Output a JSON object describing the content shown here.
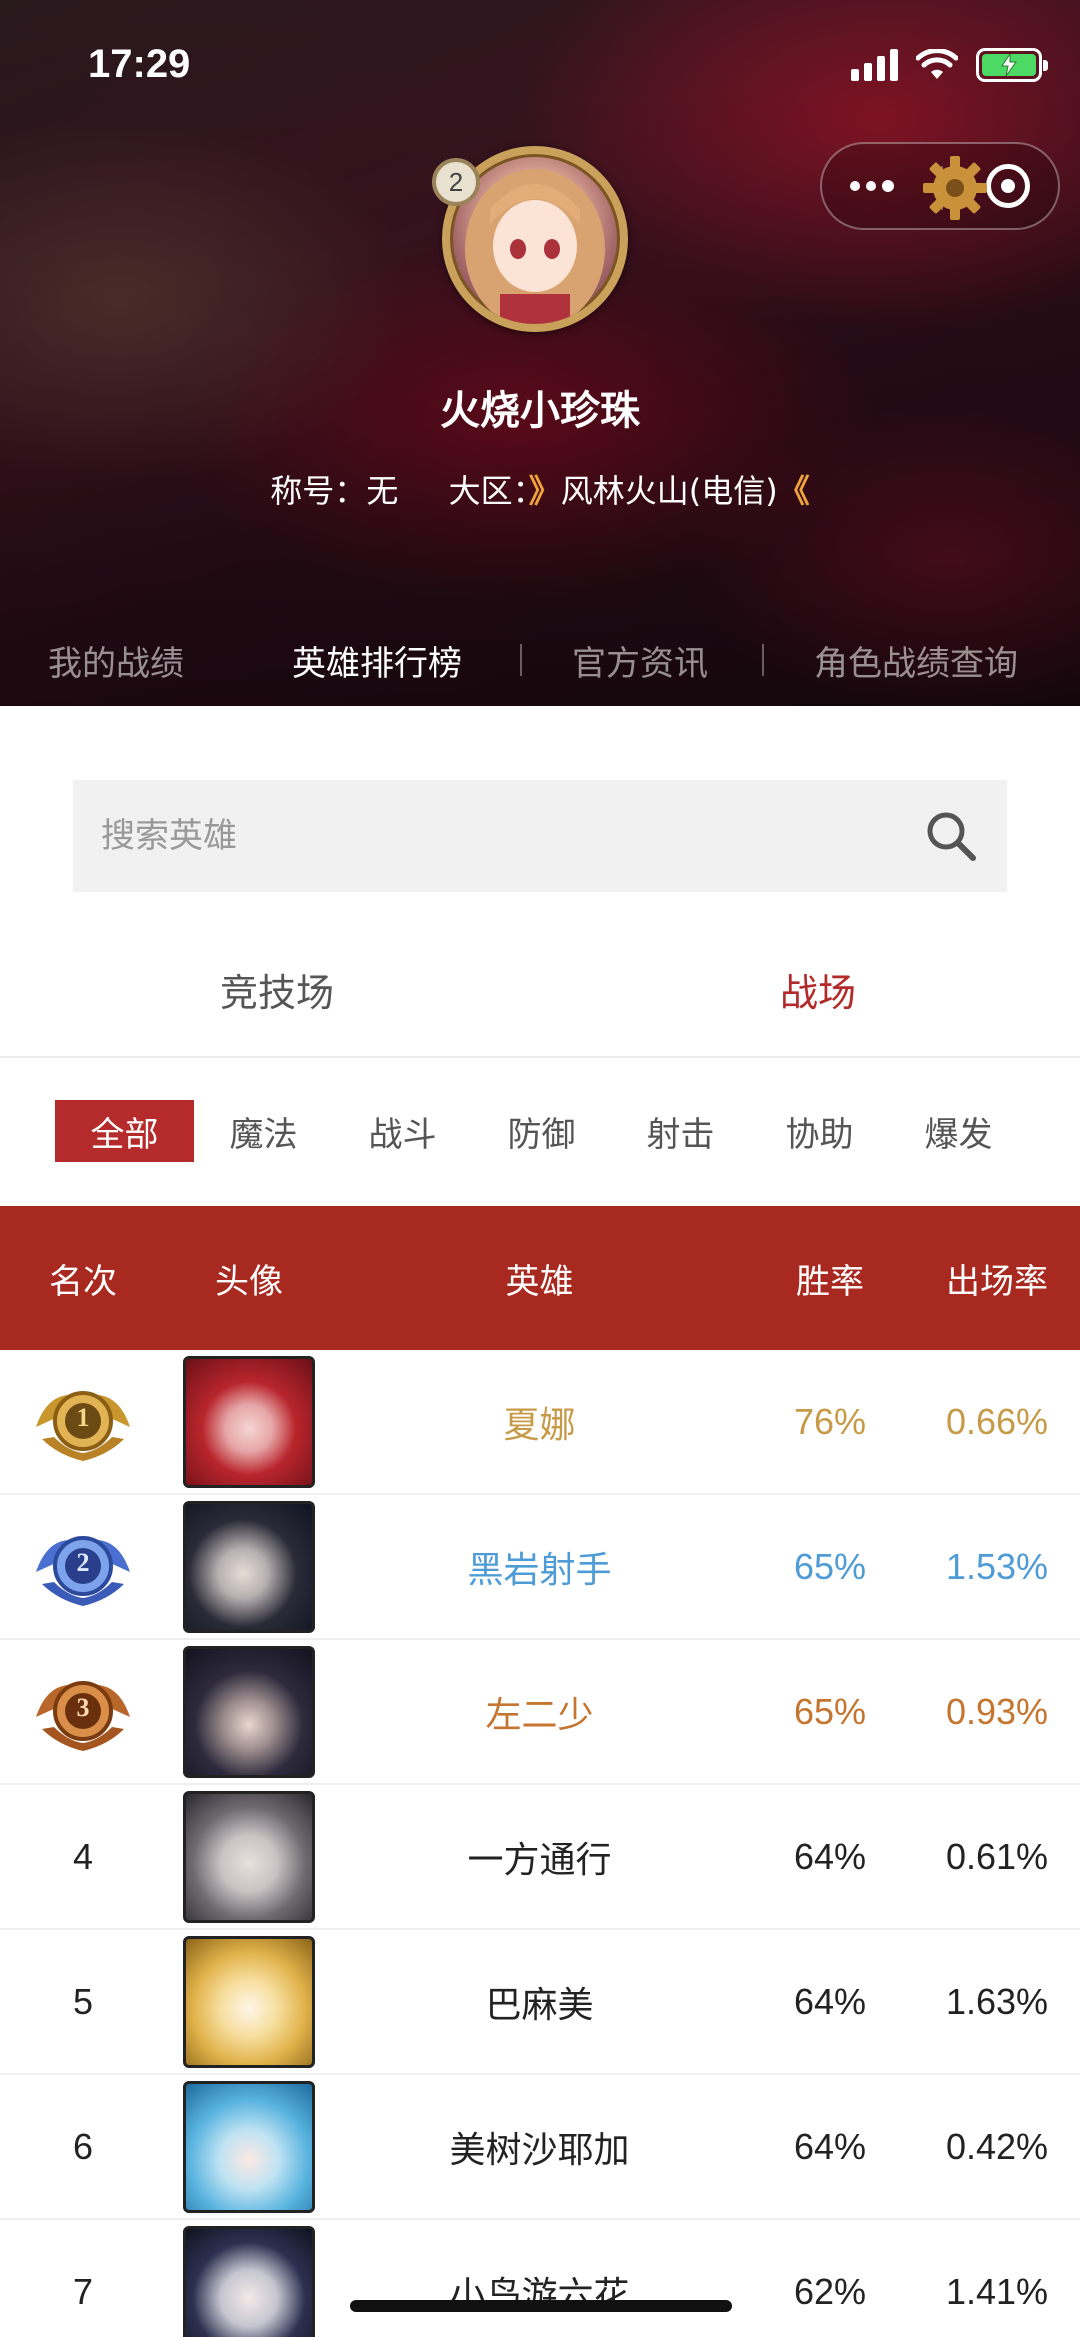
{
  "status_bar": {
    "time": "17:29"
  },
  "profile": {
    "badge_level": "2",
    "name": "火烧小珍珠",
    "title_label": "称号：",
    "title_value": "无",
    "region_label": "大区：",
    "region_arrow_left": "》",
    "region_value": "风林火山(电信)",
    "region_arrow_right": "《"
  },
  "top_nav": [
    {
      "label": "我的战绩"
    },
    {
      "label": "英雄排行榜"
    },
    {
      "label": "官方资讯"
    },
    {
      "label": "角色战绩查询"
    }
  ],
  "search": {
    "placeholder": "搜索英雄",
    "value": ""
  },
  "mode_tabs": [
    {
      "label": "竞技场"
    },
    {
      "label": "战场"
    }
  ],
  "categories": [
    "全部",
    "魔法",
    "战斗",
    "防御",
    "射击",
    "协助",
    "爆发"
  ],
  "table": {
    "headers": {
      "rank": "名次",
      "avatar": "头像",
      "hero": "英雄",
      "win_rate": "胜率",
      "pick_rate": "出场率"
    },
    "rows": [
      {
        "rank": "1",
        "hero": "夏娜",
        "win_rate": "76%",
        "pick_rate": "0.66%"
      },
      {
        "rank": "2",
        "hero": "黑岩射手",
        "win_rate": "65%",
        "pick_rate": "1.53%"
      },
      {
        "rank": "3",
        "hero": "左二少",
        "win_rate": "65%",
        "pick_rate": "0.93%"
      },
      {
        "rank": "4",
        "hero": "一方通行",
        "win_rate": "64%",
        "pick_rate": "0.61%"
      },
      {
        "rank": "5",
        "hero": "巴麻美",
        "win_rate": "64%",
        "pick_rate": "1.63%"
      },
      {
        "rank": "6",
        "hero": "美树沙耶加",
        "win_rate": "64%",
        "pick_rate": "0.42%"
      },
      {
        "rank": "7",
        "hero": "小鸟游六花",
        "win_rate": "62%",
        "pick_rate": "1.41%"
      }
    ]
  },
  "colors": {
    "accent_red": "#b52b2b",
    "table_header": "#a8291f",
    "rank1": "#c79a48",
    "rank2": "#4e9bd6",
    "rank3": "#c4752f"
  }
}
